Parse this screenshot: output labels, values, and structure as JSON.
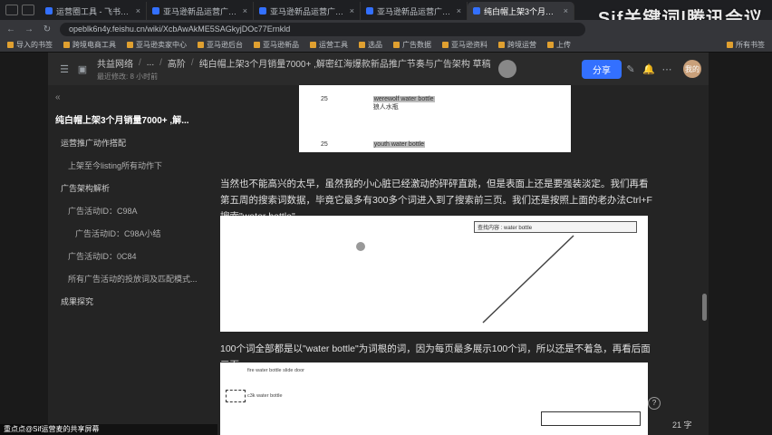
{
  "browser": {
    "tabs": [
      {
        "label": "运营圈工具 - 飞书云文档",
        "active": false
      },
      {
        "label": "亚马逊新品运营广告策略",
        "active": false
      },
      {
        "label": "亚马逊新品运营广告策略",
        "active": false
      },
      {
        "label": "亚马逊新品运营广告打法",
        "active": false
      },
      {
        "label": "纯白帽上架3个月销量7000+",
        "active": true
      }
    ],
    "url": "opeblk6n4y.feishu.cn/wiki/XcbAwAkME5SAGkyjDOc77Ernkld",
    "bookmarks": [
      "导入的书签",
      "跨境电商工具",
      "亚马逊卖家中心",
      "亚马逊后台",
      "亚马逊新品",
      "运营工具",
      "选品",
      "广告数据",
      "亚马逊资料",
      "跨境运营",
      "上传"
    ],
    "bookmarks_right": "所有书签",
    "watermark": "Sif关键词|腾讯会议"
  },
  "header": {
    "crumb1": "共益网络",
    "crumb2": "...",
    "crumb3": "高阶",
    "title": "纯白帽上架3个月销量7000+ ,解密红海爆款新品推广节奏与广告架构 草稿",
    "subinfo": "最近修改: 8 小时前",
    "share": "分享",
    "me": "我的"
  },
  "outline": {
    "collapse": "«",
    "items": [
      {
        "label": "纯白帽上架3个月销量7000+ ,解...",
        "level": "h1"
      },
      {
        "label": "运营推广动作搭配",
        "level": "l2"
      },
      {
        "label": "上架至今listing所有动作下",
        "level": "l3"
      },
      {
        "label": "广告架构解析",
        "level": "l2"
      },
      {
        "label": "广告活动ID：C98A",
        "level": "l3"
      },
      {
        "label": "广告活动ID：C98A小结",
        "level": "l4"
      },
      {
        "label": "广告活动ID：0C84",
        "level": "l3"
      },
      {
        "label": "所有广告活动的投放词及匹配模式...",
        "level": "l3"
      },
      {
        "label": "成果探究",
        "level": "l2"
      }
    ]
  },
  "doc": {
    "img1_rows": [
      {
        "rank": "25",
        "term": "werewolf water bottle",
        "sub": "狼人水瓶"
      },
      {
        "rank": "25",
        "term": "youth water bottle",
        "sub": ""
      }
    ],
    "para1": "当然也不能高兴的太早，虽然我的小心脏已经激动的砰砰直跳，但是表面上还是要强装淡定。我们再看第五周的搜索词数据，毕竟它最多有300多个词进入到了搜索前三页。我们还是按照上面的老办法Ctrl+F 搜索\"water bottle\"",
    "para2": "100个词全部都是以\"water bottle\"为词根的词，因为每页最多展示100个词，所以还是不着急，再看后面三页。",
    "img2_search_label": "查找内容",
    "img2_search_value": "water bottle",
    "img3_row1": "fire water bottle slide door",
    "img3_row2": "c3k water bottle"
  },
  "status": {
    "wordcount": "21 字",
    "help": "?",
    "share_text": "重点点@Sif运营麦的共享屏幕"
  }
}
